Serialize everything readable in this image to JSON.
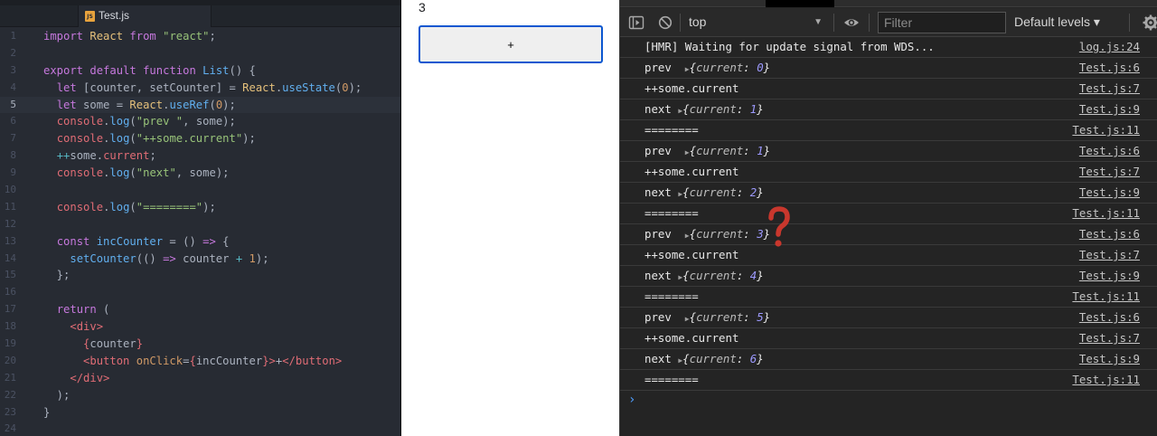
{
  "editor": {
    "tab_label": "Test.js",
    "tab_badge": "JS",
    "lines": [
      {
        "n": "1",
        "html": "<span class='kw'>import</span> <span class='cls'>React</span> <span class='kw'>from</span> <span class='str'>\"react\"</span>;"
      },
      {
        "n": "2",
        "html": ""
      },
      {
        "n": "3",
        "html": "<span class='kw'>export</span> <span class='kw'>default</span> <span class='kw'>function</span> <span class='fn'>List</span>() {"
      },
      {
        "n": "4",
        "html": "  <span class='kw'>let</span> [counter, setCounter] = <span class='cls'>React</span>.<span class='fn'>useState</span>(<span class='num'>0</span>);"
      },
      {
        "n": "5",
        "html": "  <span class='kw'>let</span> some = <span class='cls'>React</span>.<span class='fn'>useRef</span>(<span class='num'>0</span>);"
      },
      {
        "n": "6",
        "html": "  <span class='prop'>console</span>.<span class='fn'>log</span>(<span class='str'>\"prev \"</span>, some);"
      },
      {
        "n": "7",
        "html": "  <span class='prop'>console</span>.<span class='fn'>log</span>(<span class='str'>\"++some.current\"</span>);"
      },
      {
        "n": "8",
        "html": "  <span class='op'>++</span>some.<span class='prop'>current</span>;"
      },
      {
        "n": "9",
        "html": "  <span class='prop'>console</span>.<span class='fn'>log</span>(<span class='str'>\"next\"</span>, some);"
      },
      {
        "n": "10",
        "html": ""
      },
      {
        "n": "11",
        "html": "  <span class='prop'>console</span>.<span class='fn'>log</span>(<span class='str'>\"========\"</span>);"
      },
      {
        "n": "12",
        "html": ""
      },
      {
        "n": "13",
        "html": "  <span class='kw'>const</span> <span class='fn'>incCounter</span> = () <span class='kw'>=&gt;</span> {"
      },
      {
        "n": "14",
        "html": "    <span class='fn'>setCounter</span>(() <span class='kw'>=&gt;</span> counter <span class='op'>+</span> <span class='num'>1</span>);"
      },
      {
        "n": "15",
        "html": "  };"
      },
      {
        "n": "16",
        "html": ""
      },
      {
        "n": "17",
        "html": "  <span class='kw'>return</span> ("
      },
      {
        "n": "18",
        "html": "    <span class='tag'>&lt;div&gt;</span>"
      },
      {
        "n": "19",
        "html": "      <span class='tag'>{</span>counter<span class='tag'>}</span>"
      },
      {
        "n": "20",
        "html": "      <span class='tag'>&lt;button</span> <span class='attr'>onClick</span>=<span class='tag'>{</span>incCounter<span class='tag'>}</span><span class='tag'>&gt;</span>+<span class='tag'>&lt;/button&gt;</span>"
      },
      {
        "n": "21",
        "html": "    <span class='tag'>&lt;/div&gt;</span>"
      },
      {
        "n": "22",
        "html": "  );"
      },
      {
        "n": "23",
        "html": "}"
      },
      {
        "n": "24",
        "html": ""
      }
    ],
    "active_line": "5"
  },
  "preview": {
    "counter": "3",
    "button_label": "+"
  },
  "devtools": {
    "context": "top",
    "filter_placeholder": "Filter",
    "levels": "Default levels ▾",
    "logs": [
      {
        "type": "text",
        "msg": "[HMR] Waiting for update signal from WDS...",
        "src": "log.js:24"
      },
      {
        "type": "obj",
        "label": "prev",
        "pad": "  ",
        "current": "0",
        "src": "Test.js:6"
      },
      {
        "type": "text",
        "msg": "++some.current",
        "src": "Test.js:7"
      },
      {
        "type": "obj",
        "label": "next",
        "pad": " ",
        "current": "1",
        "src": "Test.js:9"
      },
      {
        "type": "text",
        "msg": "========",
        "src": "Test.js:11"
      },
      {
        "type": "obj",
        "label": "prev",
        "pad": "  ",
        "current": "1",
        "src": "Test.js:6"
      },
      {
        "type": "text",
        "msg": "++some.current",
        "src": "Test.js:7"
      },
      {
        "type": "obj",
        "label": "next",
        "pad": " ",
        "current": "2",
        "src": "Test.js:9"
      },
      {
        "type": "text",
        "msg": "========",
        "src": "Test.js:11"
      },
      {
        "type": "obj",
        "label": "prev",
        "pad": "  ",
        "current": "3",
        "src": "Test.js:6"
      },
      {
        "type": "text",
        "msg": "++some.current",
        "src": "Test.js:7"
      },
      {
        "type": "obj",
        "label": "next",
        "pad": " ",
        "current": "4",
        "src": "Test.js:9"
      },
      {
        "type": "text",
        "msg": "========",
        "src": "Test.js:11"
      },
      {
        "type": "obj",
        "label": "prev",
        "pad": "  ",
        "current": "5",
        "src": "Test.js:6"
      },
      {
        "type": "text",
        "msg": "++some.current",
        "src": "Test.js:7"
      },
      {
        "type": "obj",
        "label": "next",
        "pad": " ",
        "current": "6",
        "src": "Test.js:9"
      },
      {
        "type": "text",
        "msg": "========",
        "src": "Test.js:11"
      }
    ],
    "object_key": "current",
    "prompt_symbol": "›"
  },
  "colors": {
    "editor_bg": "#272b33",
    "accent_blue": "#0b57d0",
    "annotation_red": "#c8372d"
  },
  "icons": [
    "sidebar-toggle-icon",
    "clear-console-icon",
    "eye-icon",
    "settings-gear-icon",
    "question-mark-icon",
    "js-file-icon"
  ]
}
